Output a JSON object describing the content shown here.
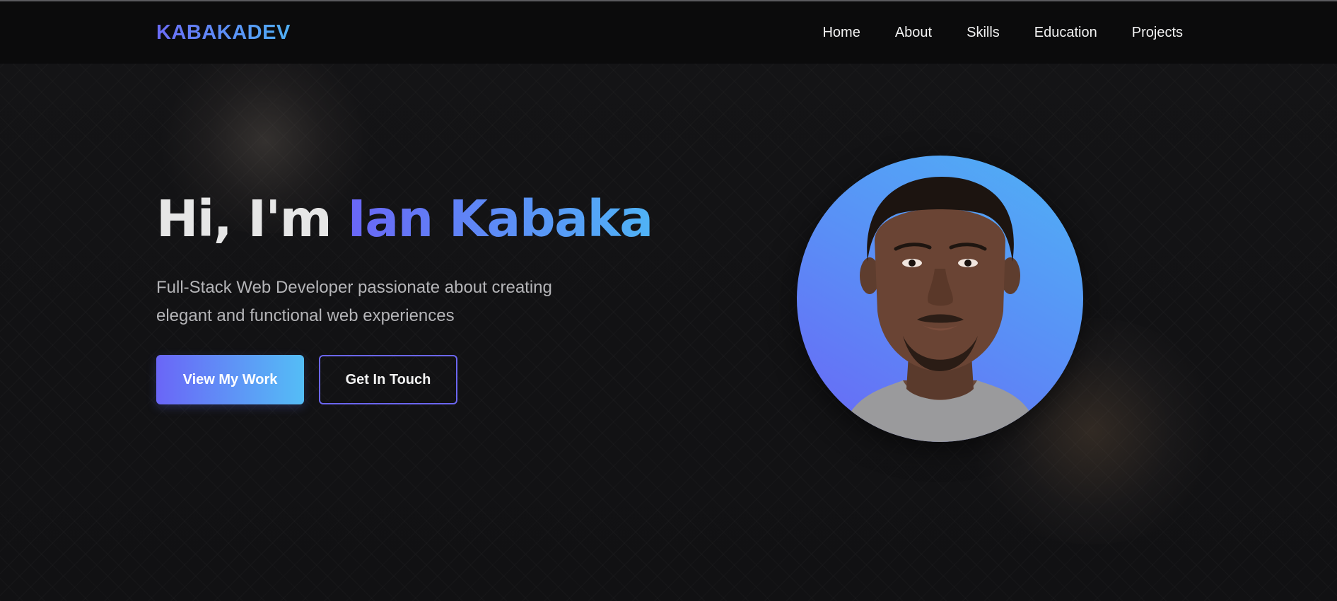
{
  "nav": {
    "logo": "KABAKADEV",
    "links": [
      "Home",
      "About",
      "Skills",
      "Education",
      "Projects"
    ]
  },
  "hero": {
    "greeting": "Hi, I'm ",
    "name": "Ian Kabaka",
    "tagline": "Full-Stack Web Developer passionate about creating elegant and functional web experiences",
    "primary_button": "View My Work",
    "secondary_button": "Get In Touch"
  },
  "colors": {
    "background": "#121214",
    "navbar": "#0b0b0c",
    "accent_start": "#6a66f6",
    "accent_end": "#4fb3f6",
    "heading": "#e6e6e6",
    "tagline": "#b5b5b8"
  },
  "icons": {
    "avatar": "profile-photo"
  }
}
